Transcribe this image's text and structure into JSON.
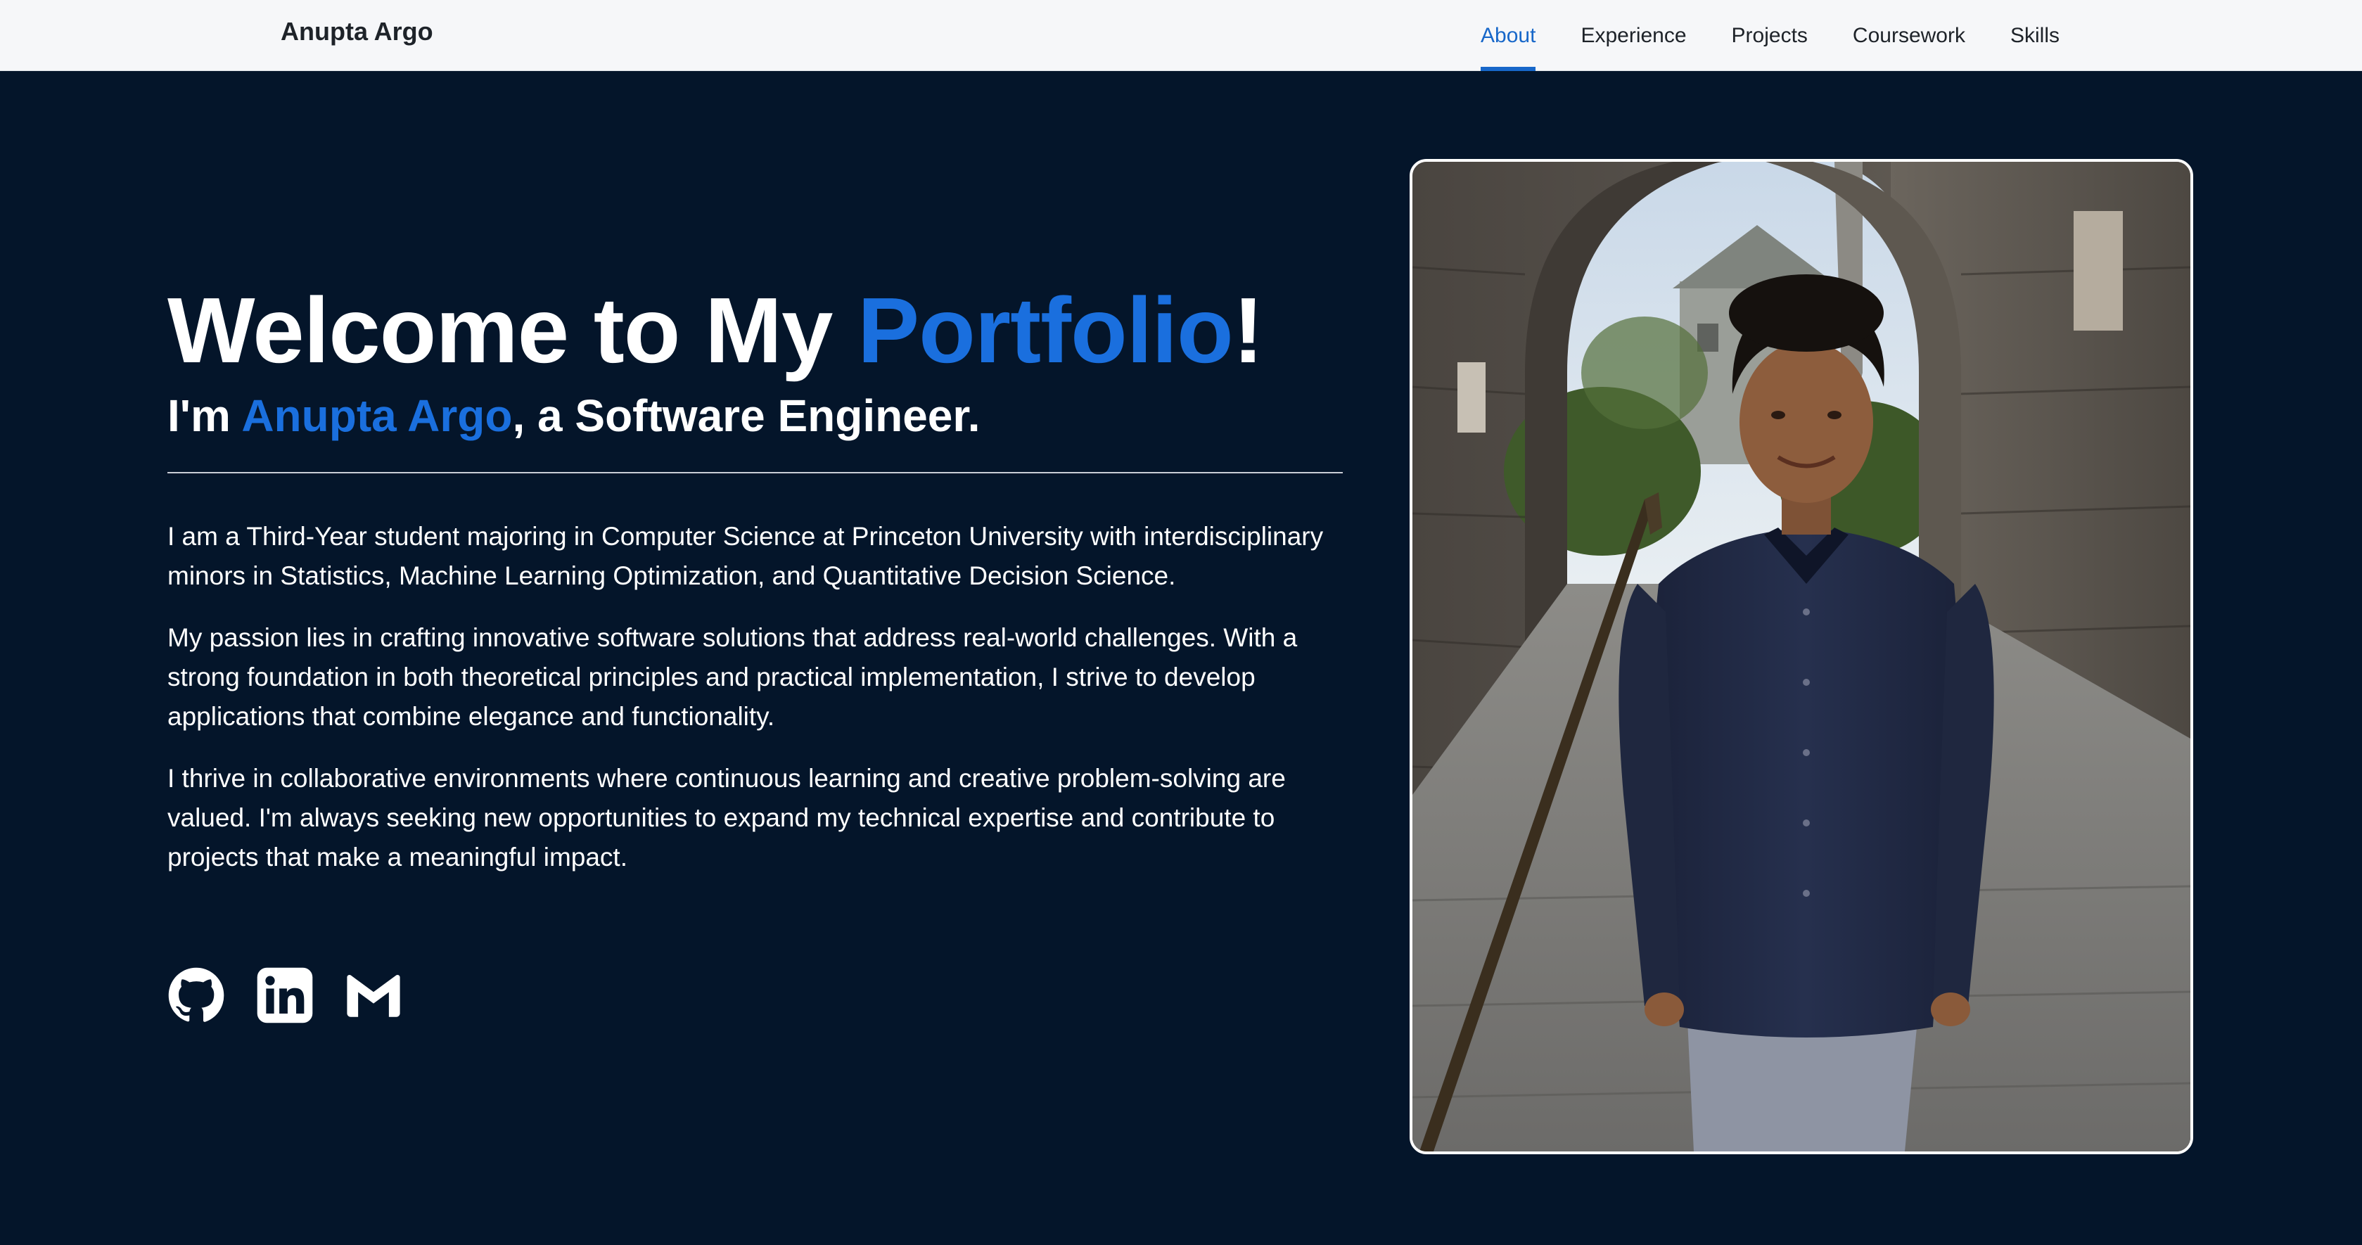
{
  "brand": "Anupta Argo",
  "nav": {
    "items": [
      "About",
      "Experience",
      "Projects",
      "Coursework",
      "Skills"
    ],
    "active": "About"
  },
  "hero": {
    "headline_prefix": "Welcome to My ",
    "headline_accent": "Portfolio",
    "headline_suffix": "!",
    "sub_prefix": "I'm ",
    "sub_name": "Anupta Argo",
    "sub_suffix": ", a Software Engineer.",
    "paragraphs": [
      "I am a Third-Year student majoring in Computer Science at Princeton University with interdisciplinary minors in Statistics, Machine Learning Optimization, and Quantitative Decision Science.",
      "My passion lies in crafting innovative software solutions that address real-world challenges. With a strong foundation in both theoretical principles and practical implementation, I strive to develop applications that combine elegance and functionality.",
      "I thrive in collaborative environments where continuous learning and creative problem-solving are valued. I'm always seeking new opportunities to expand my technical expertise and contribute to projects that make a meaningful impact."
    ]
  },
  "socials": [
    {
      "name": "github",
      "icon": "github-icon"
    },
    {
      "name": "linkedin",
      "icon": "linkedin-icon"
    },
    {
      "name": "gmail",
      "icon": "gmail-icon"
    }
  ],
  "colors": {
    "background": "#04152a",
    "accent": "#1a6fde",
    "navbar": "#f6f7f9",
    "nav_active": "#1767c9"
  }
}
